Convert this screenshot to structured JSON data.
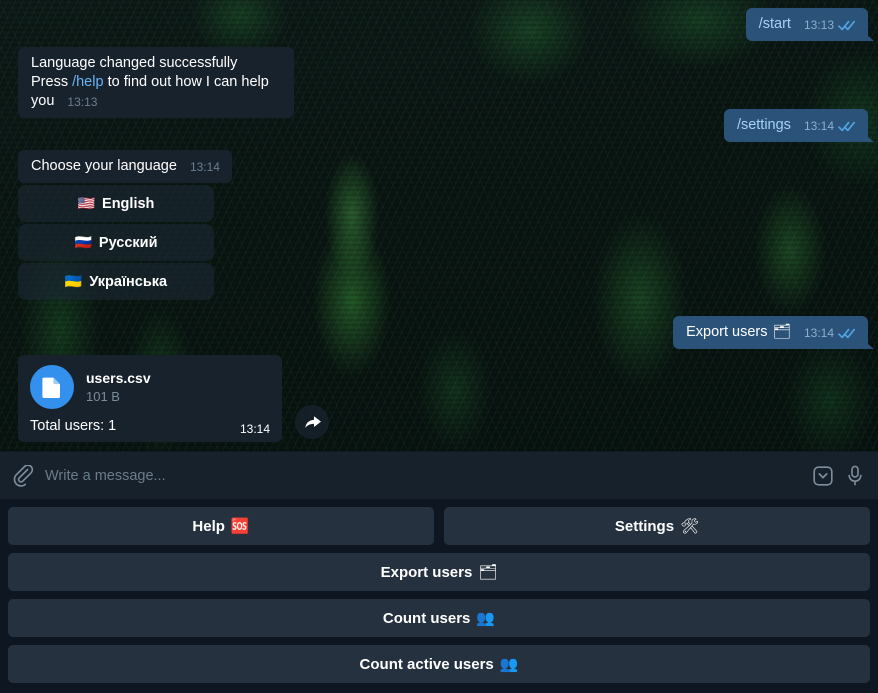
{
  "app": {
    "name": "Telegram Desktop",
    "theme": "dark",
    "accent_color": "#3390ec",
    "outgoing_bubble_color": "#2b5278",
    "incoming_bubble_color": "#18222d",
    "composer_bg_color": "#17212b",
    "keyboard_bg_color": "#0e1621",
    "keyboard_button_color": "#26313f",
    "wallpaper": "dark-forest-photo"
  },
  "messages": [
    {
      "id": "m1",
      "direction": "out",
      "text": "/start",
      "is_command": true,
      "time": "13:13",
      "status": "read"
    },
    {
      "id": "m2",
      "direction": "in",
      "line1": "Language changed successfully",
      "line2_before": "Press ",
      "line2_link": "/help",
      "line2_after": " to find out how I can help you",
      "time": "13:13"
    },
    {
      "id": "m3",
      "direction": "out",
      "text": "/settings",
      "is_command": true,
      "time": "13:14",
      "status": "read"
    },
    {
      "id": "m4",
      "direction": "in",
      "text": "Choose your language",
      "time": "13:14"
    },
    {
      "id": "m5",
      "direction": "out",
      "text": "Export users",
      "emoji": "🗂",
      "time": "13:14",
      "status": "read"
    },
    {
      "id": "m6",
      "direction": "in",
      "type": "document",
      "file_name": "users.csv",
      "file_size": "101 B",
      "caption": "Total users: 1",
      "time": "13:14"
    }
  ],
  "inline_keyboard": {
    "buttons": [
      {
        "flag": "🇺🇸",
        "label": "English"
      },
      {
        "flag": "🇷🇺",
        "label": "Русский"
      },
      {
        "flag": "🇺🇦",
        "label": "Українська"
      }
    ]
  },
  "document_message": {
    "icon": "document-icon",
    "file_name": "users.csv",
    "file_size": "101 B",
    "caption": "Total users: 1",
    "time": "13:14"
  },
  "forward_button": {
    "icon": "forward-arrow-icon"
  },
  "composer": {
    "attach_icon": "paperclip-icon",
    "placeholder": "Write a message...",
    "value": "",
    "hide_keyboard_icon": "chevron-down-box-icon",
    "voice_icon": "microphone-icon"
  },
  "reply_keyboard": {
    "rows": [
      [
        {
          "label": "Help",
          "emoji": "🆘"
        },
        {
          "label": "Settings",
          "emoji": "🛠"
        }
      ],
      [
        {
          "label": "Export users",
          "emoji": "🗂"
        }
      ],
      [
        {
          "label": "Count users",
          "emoji": "👥"
        }
      ],
      [
        {
          "label": "Count active users",
          "emoji": "👥"
        }
      ]
    ]
  }
}
